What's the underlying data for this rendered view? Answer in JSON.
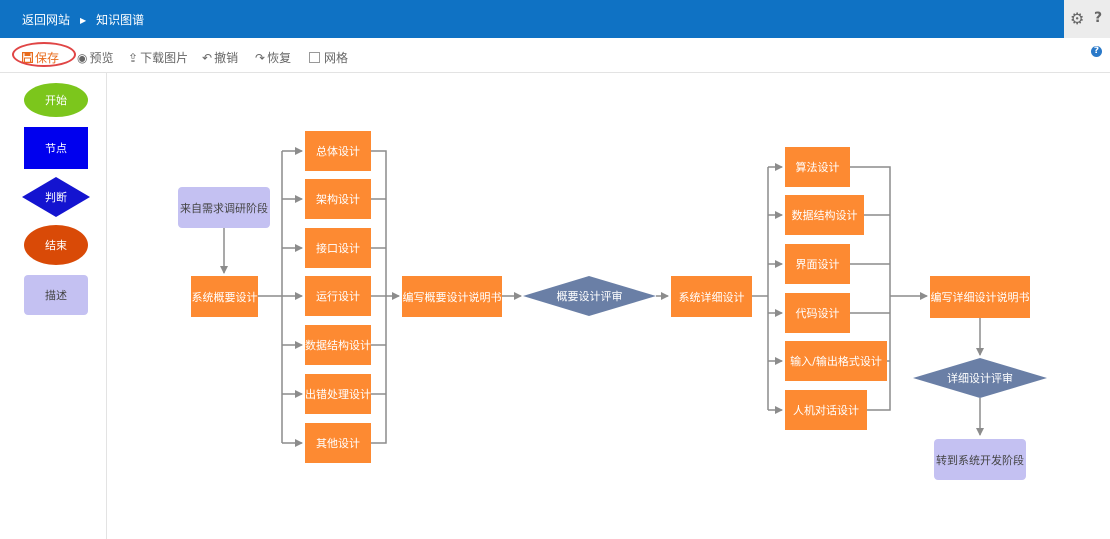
{
  "header": {
    "back_label": "返回网站",
    "separator": "▶",
    "title": "知识图谱"
  },
  "toolbar": {
    "save": "保存",
    "preview": "预览",
    "download": "下载图片",
    "undo": "撤销",
    "redo": "恢复",
    "grid": "网格"
  },
  "palette": {
    "start": "开始",
    "node": "节点",
    "decision": "判断",
    "end": "结束",
    "description": "描述"
  },
  "diagram": {
    "from_requirements": "来自需求调研阶段",
    "overview_design": "系统概要设计",
    "overall_design": "总体设计",
    "architecture_design": "架构设计",
    "interface_design": "接口设计",
    "runtime_design": "运行设计",
    "data_structure_design": "数据结构设计",
    "error_handling_design": "出错处理设计",
    "other_design": "其他设计",
    "write_overview_doc": "编写概要设计说明书",
    "overview_review": "概要设计评审",
    "detailed_design": "系统详细设计",
    "algorithm_design": "算法设计",
    "data_structure_design_2": "数据结构设计",
    "ui_design": "界面设计",
    "code_design": "代码设计",
    "io_format_design": "输入/输出格式设计",
    "hci_design": "人机对话设计",
    "write_detailed_doc": "编写详细设计说明书",
    "detailed_review": "详细设计评审",
    "to_dev_phase": "转到系统开发阶段"
  },
  "colors": {
    "header": "#0f72c4",
    "process": "#fd8a32",
    "decision": "#6a7fa6",
    "description": "#c4c1f2",
    "start": "#7cc61c",
    "end": "#d94a07",
    "node": "#0000ee",
    "palette_decision": "#1414d0",
    "connector": "#8c8c8c"
  },
  "icons": {
    "save": "floppy-icon",
    "preview": "eye-icon",
    "download": "upload-tray-icon",
    "undo": "undo-arrow-icon",
    "redo": "redo-arrow-icon",
    "settings": "gear-icon",
    "help": "question-icon"
  }
}
